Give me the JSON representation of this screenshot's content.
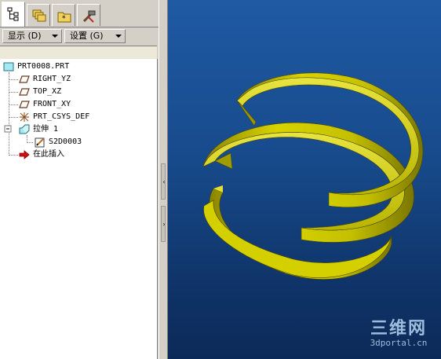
{
  "left_panel": {
    "tabs": [
      {
        "icon": "model-tree-icon",
        "active": true
      },
      {
        "icon": "layers-icon",
        "active": false
      },
      {
        "icon": "favorites-folder-icon",
        "active": false
      },
      {
        "icon": "tools-icon",
        "active": false
      }
    ],
    "toolbar": {
      "show_label": "显示 (D)",
      "settings_label": "设置 (G)"
    },
    "tree": {
      "root": "PRT0008.PRT",
      "items": [
        {
          "label": "RIGHT_YZ",
          "icon": "datum-plane-icon"
        },
        {
          "label": "TOP_XZ",
          "icon": "datum-plane-icon"
        },
        {
          "label": "FRONT_XY",
          "icon": "datum-plane-icon"
        },
        {
          "label": "PRT_CSYS_DEF",
          "icon": "csys-icon"
        },
        {
          "label": "拉伸 1",
          "icon": "extrude-icon"
        },
        {
          "label": "S2D0003",
          "icon": "sketch-icon"
        },
        {
          "label": "在此插入",
          "icon": "insert-here-arrow-icon"
        }
      ]
    }
  },
  "viewport": {
    "model_color": "#d8d400",
    "background_top": "#1f5aa3",
    "background_bottom": "#0c2a58"
  },
  "watermark": {
    "title": "三维网",
    "url": "3dportal.cn"
  }
}
